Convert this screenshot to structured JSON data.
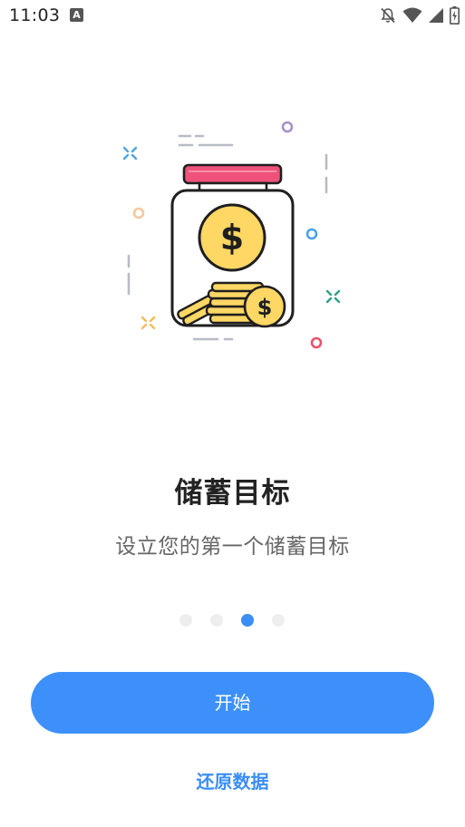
{
  "status_bar": {
    "time": "11:03",
    "notification_icon": "A"
  },
  "onboarding": {
    "title": "储蓄目标",
    "subtitle": "设立您的第一个储蓄目标",
    "page_count": 4,
    "active_page": 3,
    "illustration": "savings-jar-icon"
  },
  "actions": {
    "start_label": "开始",
    "restore_label": "还原数据"
  },
  "colors": {
    "accent": "#3d90f9",
    "active_dot": "#3a8ef6",
    "inactive_dot": "#eeeeee",
    "jar_lid": "#f0517a",
    "coin": "#ffd764",
    "title_text": "#222222",
    "subtitle_text": "#666666"
  }
}
